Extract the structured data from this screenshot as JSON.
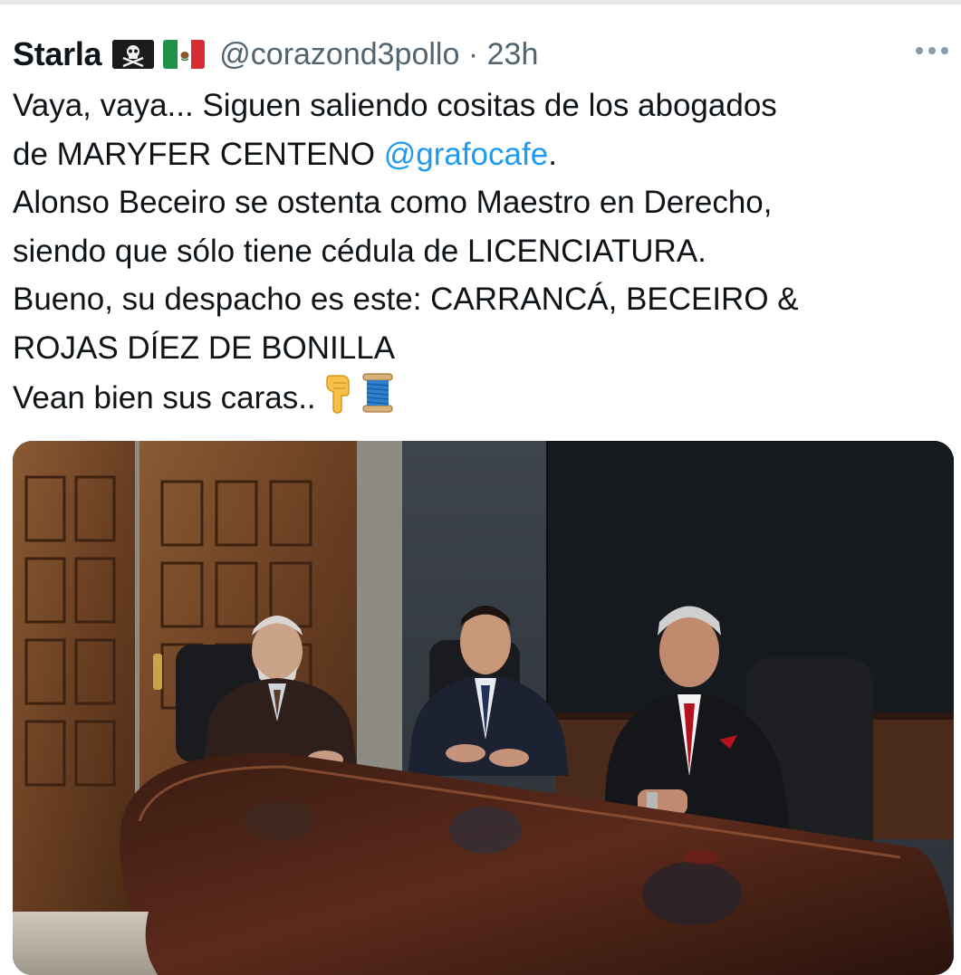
{
  "tweet": {
    "display_name": "Starla",
    "handle": "@corazond3pollo",
    "separator": "·",
    "time": "23h",
    "text_lines": [
      "Vaya, vaya... Siguen saliendo cositas de los abogados",
      "Alonso Beceiro se ostenta como Maestro en Derecho,",
      "siendo que sólo tiene cédula de LICENCIATURA.",
      "Bueno, su despacho es este: CARRANCÁ, BECEIRO &",
      "ROJAS DÍEZ DE BONILLA",
      "Vean bien sus caras.."
    ],
    "line2_prefix": "de MARYFER CENTENO ",
    "mention": "@grafocafe",
    "line2_suffix": ".",
    "emojis": [
      "backhand-index-pointing-down",
      "spool-of-thread"
    ],
    "name_flags": [
      "pirate-flag",
      "mexico-flag"
    ]
  },
  "photo": {
    "description_icon": "photo-three-lawyers-at-conference-table"
  },
  "colors": {
    "text": "#0f1419",
    "secondary": "#536471",
    "link": "#1d9bf0"
  }
}
